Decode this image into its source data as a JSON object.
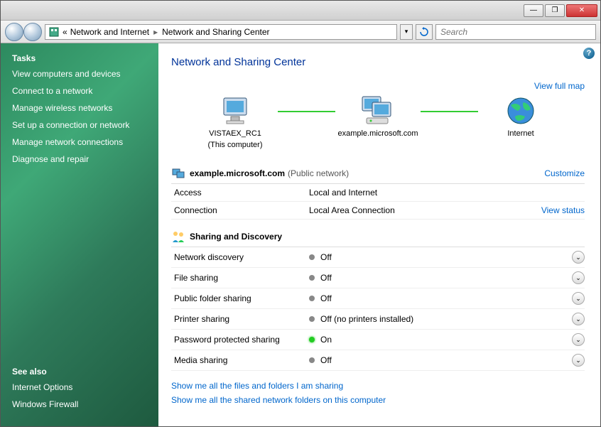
{
  "titlebar": {
    "min": "—",
    "max": "❐",
    "close": "✕"
  },
  "nav": {
    "crumb_root": "«",
    "crumb1": "Network and Internet",
    "crumb2": "Network and Sharing Center",
    "search_placeholder": "Search"
  },
  "sidebar": {
    "tasks_heading": "Tasks",
    "tasks": [
      "View computers and devices",
      "Connect to a network",
      "Manage wireless networks",
      "Set up a connection or network",
      "Manage network connections",
      "Diagnose and repair"
    ],
    "seealso_heading": "See also",
    "seealso": [
      "Internet Options",
      "Windows Firewall"
    ]
  },
  "content": {
    "title": "Network and Sharing Center",
    "viewfullmap": "View full map",
    "node1": "VISTAEX_RC1",
    "node1_sub": "(This computer)",
    "node2": "example.microsoft.com",
    "node3": "Internet",
    "net_name": "example.microsoft.com",
    "net_type": "(Public network)",
    "customize": "Customize",
    "access_label": "Access",
    "access_value": "Local and Internet",
    "connection_label": "Connection",
    "connection_value": "Local Area Connection",
    "viewstatus": "View status",
    "sharing_heading": "Sharing and Discovery",
    "sharing_rows": [
      {
        "label": "Network discovery",
        "value": "Off",
        "on": false
      },
      {
        "label": "File sharing",
        "value": "Off",
        "on": false
      },
      {
        "label": "Public folder sharing",
        "value": "Off",
        "on": false
      },
      {
        "label": "Printer sharing",
        "value": "Off (no printers installed)",
        "on": false
      },
      {
        "label": "Password protected sharing",
        "value": "On",
        "on": true
      },
      {
        "label": "Media sharing",
        "value": "Off",
        "on": false
      }
    ],
    "link_files": "Show me all the files and folders I am sharing",
    "link_folders": "Show me all the shared network folders on this computer"
  }
}
